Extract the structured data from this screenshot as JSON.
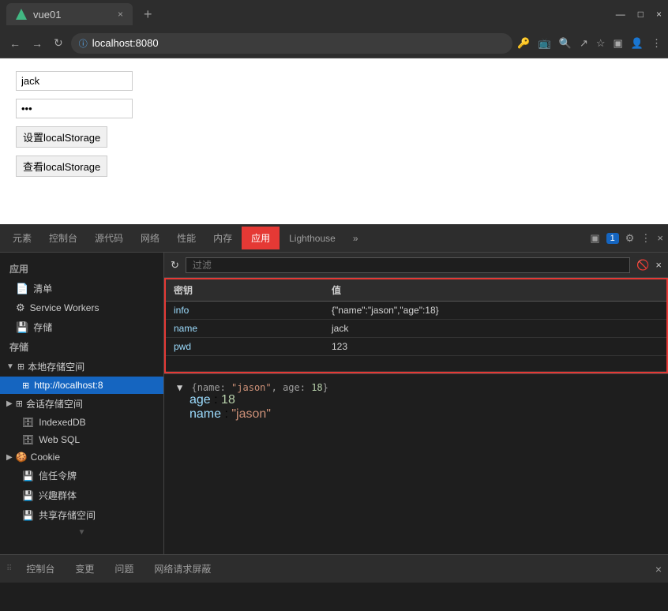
{
  "browser": {
    "tab_title": "vue01",
    "tab_close": "×",
    "tab_new": "+",
    "win_minimize": "—",
    "win_maximize": "□",
    "win_close": "×",
    "address": "localhost:8080",
    "nav_back": "←",
    "nav_forward": "→",
    "nav_refresh": "↻"
  },
  "page": {
    "input_name_value": "jack",
    "input_name_placeholder": "",
    "input_pwd_value": "···",
    "btn_set_label": "设置localStorage",
    "btn_get_label": "查看localStorage"
  },
  "devtools": {
    "tabs": [
      {
        "label": "元素",
        "active": false
      },
      {
        "label": "控制台",
        "active": false
      },
      {
        "label": "源代码",
        "active": false
      },
      {
        "label": "网络",
        "active": false
      },
      {
        "label": "性能",
        "active": false
      },
      {
        "label": "内存",
        "active": false
      },
      {
        "label": "应用",
        "active": true
      }
    ],
    "lighthouse_label": "Lighthouse",
    "more_label": "»",
    "devtools_count": "1",
    "sidebar": {
      "app_title": "应用",
      "items": [
        {
          "label": "清单",
          "icon": "📄",
          "level": 1
        },
        {
          "label": "Service Workers",
          "icon": "⚙",
          "level": 1
        },
        {
          "label": "存储",
          "icon": "💾",
          "level": 1
        }
      ],
      "storage_title": "存储",
      "local_storage_group": "本地存储空间",
      "local_storage_item": "http://localhost:8",
      "session_storage_group": "会话存储空间",
      "indexed_db": "IndexedDB",
      "web_sql": "Web SQL",
      "cookie_group": "Cookie",
      "trust_tokens": "信任令牌",
      "interest_groups": "兴趣群体",
      "shared_storage": "共享存储空间"
    },
    "filter": {
      "refresh_icon": "↻",
      "placeholder": "过滤",
      "block_icon": "🚫",
      "close_icon": "×"
    },
    "table": {
      "col_key": "密钥",
      "col_value": "值",
      "rows": [
        {
          "key": "info",
          "value": "{\"name\":\"jason\",\"age\":18}"
        },
        {
          "key": "name",
          "value": "jack"
        },
        {
          "key": "pwd",
          "value": "123"
        }
      ]
    },
    "preview": {
      "line1": "▼ {name: \"jason\", age: 18}",
      "line2_key": "age",
      "line2_val": "18",
      "line3_key": "name",
      "line3_val": "\"jason\""
    },
    "bottom_tabs": [
      {
        "label": "控制台",
        "active": false
      },
      {
        "label": "变更",
        "active": false
      },
      {
        "label": "问题",
        "active": false
      },
      {
        "label": "网络请求屏蔽",
        "active": false
      }
    ]
  }
}
